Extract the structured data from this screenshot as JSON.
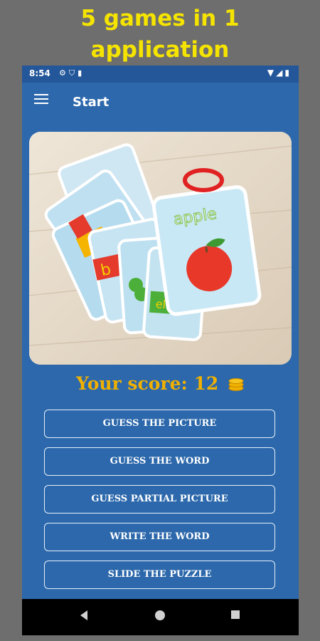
{
  "promo": {
    "line1": "5 games in 1",
    "line2": "application"
  },
  "status_bar": {
    "time": "8:54",
    "left_icons": [
      "gear-icon",
      "shield-icon",
      "sd-card-icon"
    ],
    "right_icons": [
      "wifi-icon",
      "signal-icon",
      "battery-icon"
    ]
  },
  "app_bar": {
    "title": "Start",
    "menu_icon": "hamburger-menu-icon"
  },
  "hero": {
    "card_word": "apple",
    "side_letters": [
      "b",
      "el"
    ]
  },
  "score": {
    "label": "Your score:",
    "value": "12",
    "icon": "coins-icon"
  },
  "games": [
    {
      "label": "GUESS THE PICTURE"
    },
    {
      "label": "GUESS THE WORD"
    },
    {
      "label": "GUESS PARTIAL PICTURE"
    },
    {
      "label": "WRITE THE WORD"
    },
    {
      "label": "SLIDE THE PUZZLE"
    }
  ],
  "nav": {
    "back": "back-icon",
    "home": "home-icon",
    "recents": "recents-icon"
  },
  "colors": {
    "app_blue": "#2c68ab",
    "status_blue": "#24579a",
    "promo_yellow": "#f5e400",
    "score_gold": "#f0b000"
  }
}
